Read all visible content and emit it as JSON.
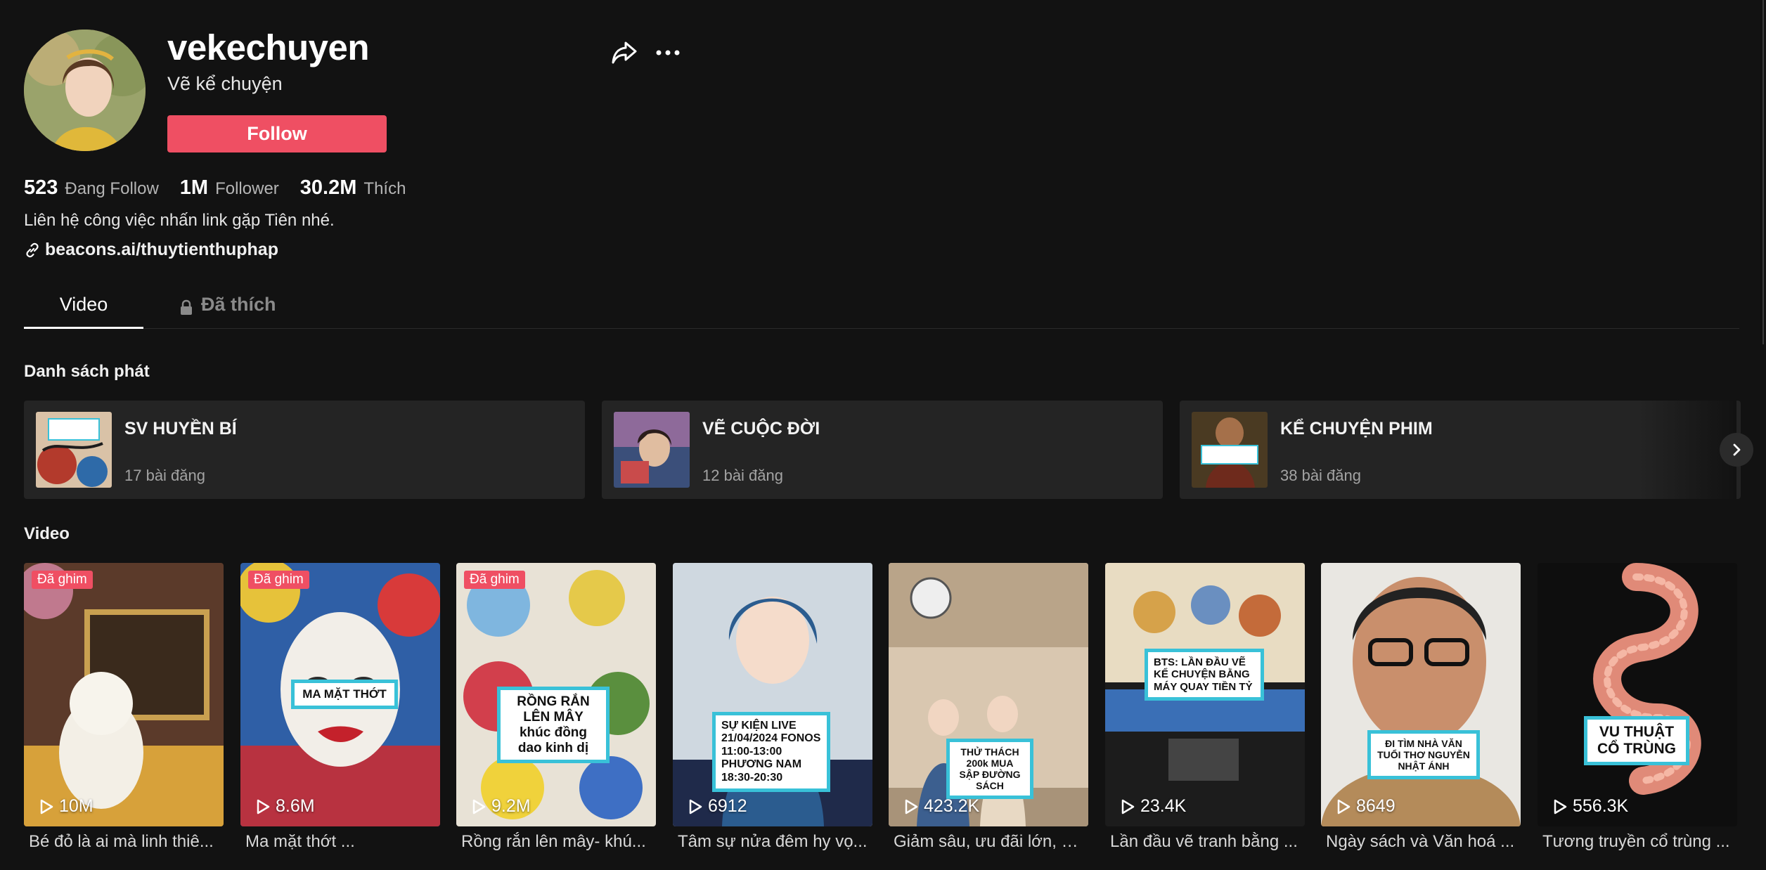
{
  "profile": {
    "username": "vekechuyen",
    "nickname": "Vẽ kể chuyện",
    "follow_label": "Follow",
    "bio": "Liên hệ công việc nhấn link gặp Tiên nhé.",
    "link": "beacons.ai/thuytienthuphap"
  },
  "stats": {
    "following_count": "523",
    "following_label": "Đang Follow",
    "followers_count": "1M",
    "followers_label": "Follower",
    "likes_count": "30.2M",
    "likes_label": "Thích"
  },
  "tabs": {
    "video": "Video",
    "liked": "Đã thích"
  },
  "sections": {
    "playlists_title": "Danh sách phát",
    "videos_title": "Video"
  },
  "playlists": [
    {
      "title": "SV HUYỀN BÍ",
      "count": "17 bài đăng"
    },
    {
      "title": "VẼ CUỘC ĐỜI",
      "count": "12 bài đăng"
    },
    {
      "title": "KỂ CHUYỆN PHIM",
      "count": "38 bài đăng"
    }
  ],
  "pinned_label": "Đã ghim",
  "videos": [
    {
      "views": "10M",
      "title": "Bé đỏ là ai mà linh thiê...",
      "pinned": true,
      "caption": ""
    },
    {
      "views": "8.6M",
      "title": "Ma mặt thớt ...",
      "pinned": true,
      "caption": "MA MẶT THỚT"
    },
    {
      "views": "9.2M",
      "title": "Rồng rắn lên mây- khú...",
      "pinned": true,
      "caption": "RỒNG RẮN LÊN MÂY khúc đồng dao kinh dị"
    },
    {
      "views": "6912",
      "title": "Tâm sự nửa đêm hy vọ...",
      "pinned": false,
      "caption": "SỰ KIỆN LIVE 21/04/2024 FONOS 11:00-13:00 PHƯƠNG NAM 18:30-20:30"
    },
    {
      "views": "423.2K",
      "title": "Giảm sâu, ưu đãi lớn, n...",
      "pinned": false,
      "caption": "THỬ THÁCH 200k MUA SẬP ĐƯỜNG SÁCH"
    },
    {
      "views": "23.4K",
      "title": "Lần đầu vẽ tranh bằng ...",
      "pinned": false,
      "caption": "BTS: LẦN ĐẦU VẼ KỂ CHUYỆN BẰNG MÁY QUAY TIỀN TỶ"
    },
    {
      "views": "8649",
      "title": "Ngày sách và Văn hoá ...",
      "pinned": false,
      "caption": "ĐI TÌM NHÀ VĂN TUỔI THƠ NGUYỄN NHẬT ÁNH"
    },
    {
      "views": "556.3K",
      "title": "Tương truyền cổ trùng ...",
      "pinned": false,
      "caption": "VU THUẬT CỔ TRÙNG"
    }
  ],
  "colors": {
    "background": "#121212",
    "accent": "#ef4f63",
    "card": "#242424",
    "caption_border": "#39c1d8"
  },
  "icons": [
    "share-icon",
    "more-icon",
    "link-icon",
    "lock-icon",
    "chevron-right-icon",
    "play-icon"
  ]
}
